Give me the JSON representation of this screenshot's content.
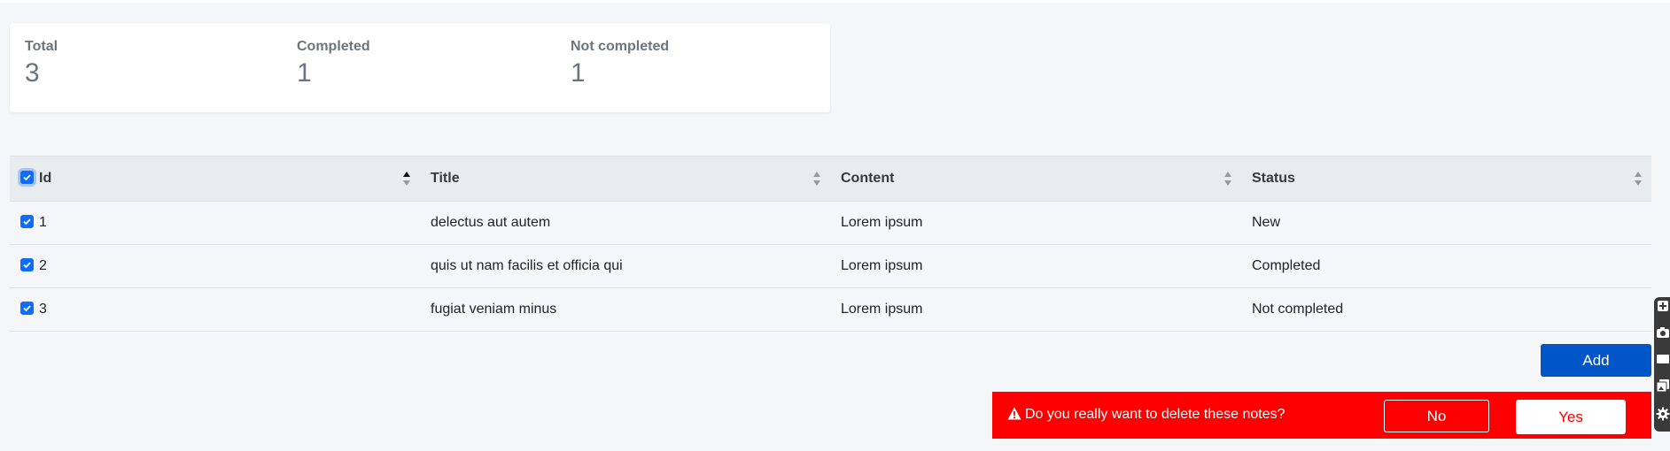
{
  "stats": {
    "total_label": "Total",
    "total_value": "3",
    "completed_label": "Completed",
    "completed_value": "1",
    "not_completed_label": "Not completed",
    "not_completed_value": "1"
  },
  "table": {
    "headers": [
      "Id",
      "Title",
      "Content",
      "Status"
    ],
    "rows": [
      {
        "id": "1",
        "title": "delectus aut autem",
        "content": "Lorem ipsum",
        "status": "New"
      },
      {
        "id": "2",
        "title": "quis ut nam facilis et officia qui",
        "content": "Lorem ipsum",
        "status": "Completed"
      },
      {
        "id": "3",
        "title": "fugiat veniam minus",
        "content": "Lorem ipsum",
        "status": "Not completed"
      }
    ]
  },
  "actions": {
    "add_label": "Add"
  },
  "confirm": {
    "message": "Do you really want to delete these notes?",
    "no_label": "No",
    "yes_label": "Yes"
  },
  "colors": {
    "primary": "#0d6efd",
    "add_button": "#0056c7",
    "danger_bar": "#ff0000",
    "background": "#f5f6f8"
  },
  "icons": {
    "checkbox": "checkmark-icon",
    "sort": "sort-icon",
    "warning": "warning-icon",
    "toolbar": [
      "add-icon",
      "camera-icon",
      "window-icon",
      "gallery-icon",
      "gear-icon"
    ]
  }
}
